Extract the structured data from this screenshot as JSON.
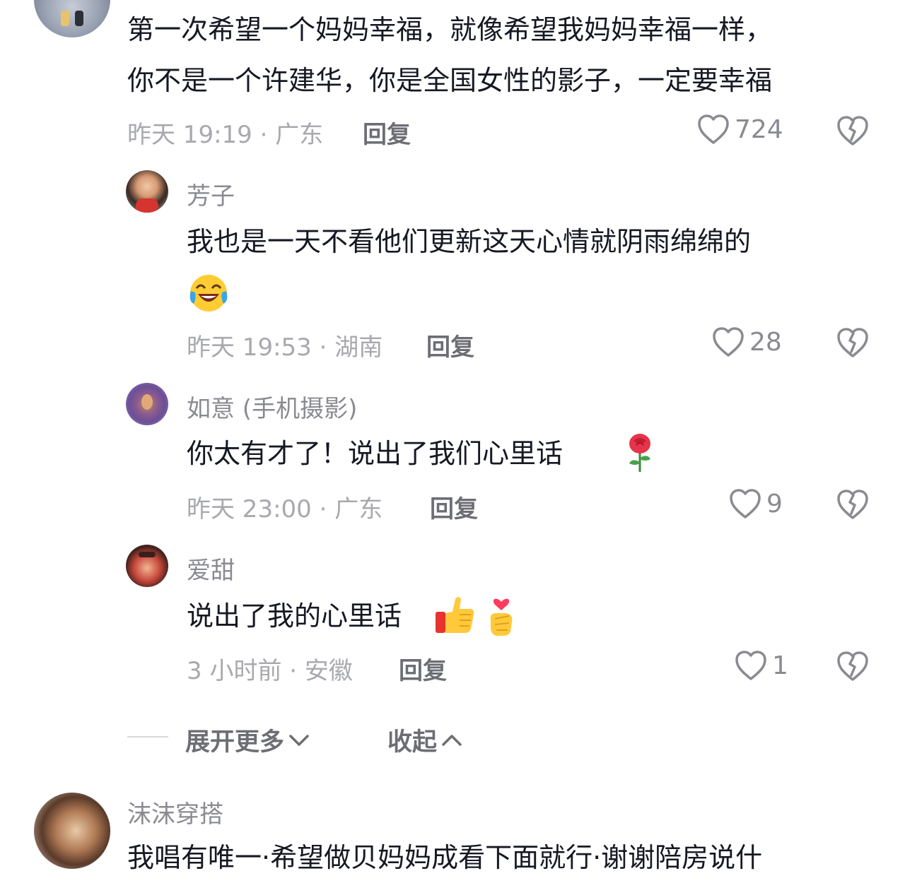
{
  "comments": {
    "top": {
      "text_line1": "第一次希望一个妈妈幸福，就像希望我妈妈幸福一样，",
      "text_line2": "你不是一个许建华，你是全国女性的影子，一定要幸福",
      "meta": "昨天 19:19 · 广东",
      "reply_label": "回复",
      "likes": "724"
    },
    "replies": [
      {
        "username": "芳子",
        "text": "我也是一天不看他们更新这天心情就阴雨绵绵的",
        "emoji": "laughing-crying-emoji",
        "meta": "昨天 19:53 · 湖南",
        "reply_label": "回复",
        "likes": "28"
      },
      {
        "username": "如意 (手机摄影)",
        "text": "你太有才了！说出了我们心里话",
        "emoji": "rose-emoji",
        "meta": "昨天 23:00 · 广东",
        "reply_label": "回复",
        "likes": "9"
      },
      {
        "username": "爱甜",
        "text": "说出了我的心里话",
        "emoji": "thumbs-up-and-finger-heart-emoji",
        "meta": "3 小时前 · 安徽",
        "reply_label": "回复",
        "likes": "1"
      }
    ],
    "next": {
      "username": "沫沫穿搭",
      "text_partial": "我唱有唯一·希望做贝妈妈成看下面就行·谢谢陪房说什"
    }
  },
  "controls": {
    "expand_more": "展开更多",
    "collapse": "收起"
  },
  "icons": {
    "like": "heart-outline-icon",
    "dislike": "broken-heart-icon",
    "chevron_down": "chevron-down-icon",
    "chevron_up": "chevron-up-icon"
  },
  "colors": {
    "text_primary": "#161823",
    "text_secondary": "#8a8b91",
    "text_meta": "#a8a9ae"
  }
}
